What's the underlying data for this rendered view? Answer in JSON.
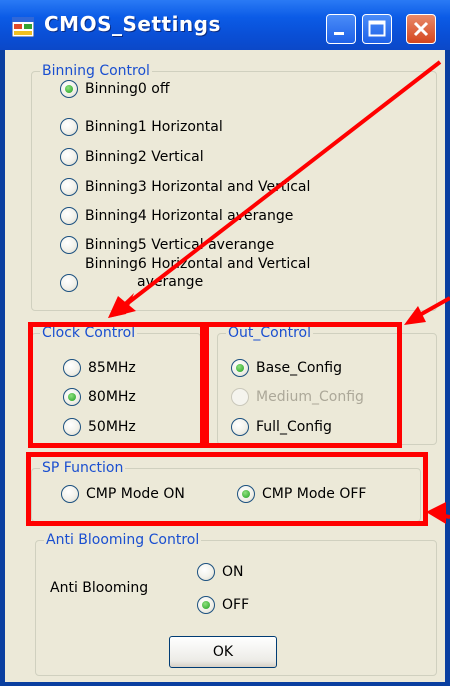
{
  "window": {
    "title": "CMOS_Settings"
  },
  "binning": {
    "legend": "Binning Control",
    "options": [
      {
        "label": "Binning0 off",
        "checked": true
      },
      {
        "label": "Binning1 Horizontal",
        "checked": false
      },
      {
        "label": "Binning2 Vertical",
        "checked": false
      },
      {
        "label": "Binning3 Horizontal and Vertical",
        "checked": false
      },
      {
        "label": "Binning4 Horizontal averange",
        "checked": false
      },
      {
        "label": "Binning5 Vertical averange",
        "checked": false
      },
      {
        "label": "Binning6 Horizontal and Vertical",
        "label_line2": "averange",
        "checked": false
      }
    ]
  },
  "clock": {
    "legend": "Clock Control",
    "options": [
      {
        "label": "85MHz",
        "checked": false
      },
      {
        "label": "80MHz",
        "checked": true
      },
      {
        "label": "50MHz",
        "checked": false
      }
    ]
  },
  "out": {
    "legend": "Out_Control",
    "options": [
      {
        "label": "Base_Config",
        "checked": true,
        "enabled": true
      },
      {
        "label": "Medium_Config",
        "checked": false,
        "enabled": false
      },
      {
        "label": "Full_Config",
        "checked": false,
        "enabled": true
      }
    ]
  },
  "sp": {
    "legend": "SP Function",
    "options": [
      {
        "label": "CMP Mode ON",
        "checked": false
      },
      {
        "label": "CMP Mode OFF",
        "checked": true
      }
    ]
  },
  "anti": {
    "legend": "Anti Blooming Control",
    "label": "Anti Blooming",
    "options": [
      {
        "label": "ON",
        "checked": false
      },
      {
        "label": "OFF",
        "checked": true
      }
    ]
  },
  "ok_label": "OK",
  "colors": {
    "annotation": "#ff0000",
    "legend_text": "#1a4fd0",
    "face": "#ece9d8"
  }
}
